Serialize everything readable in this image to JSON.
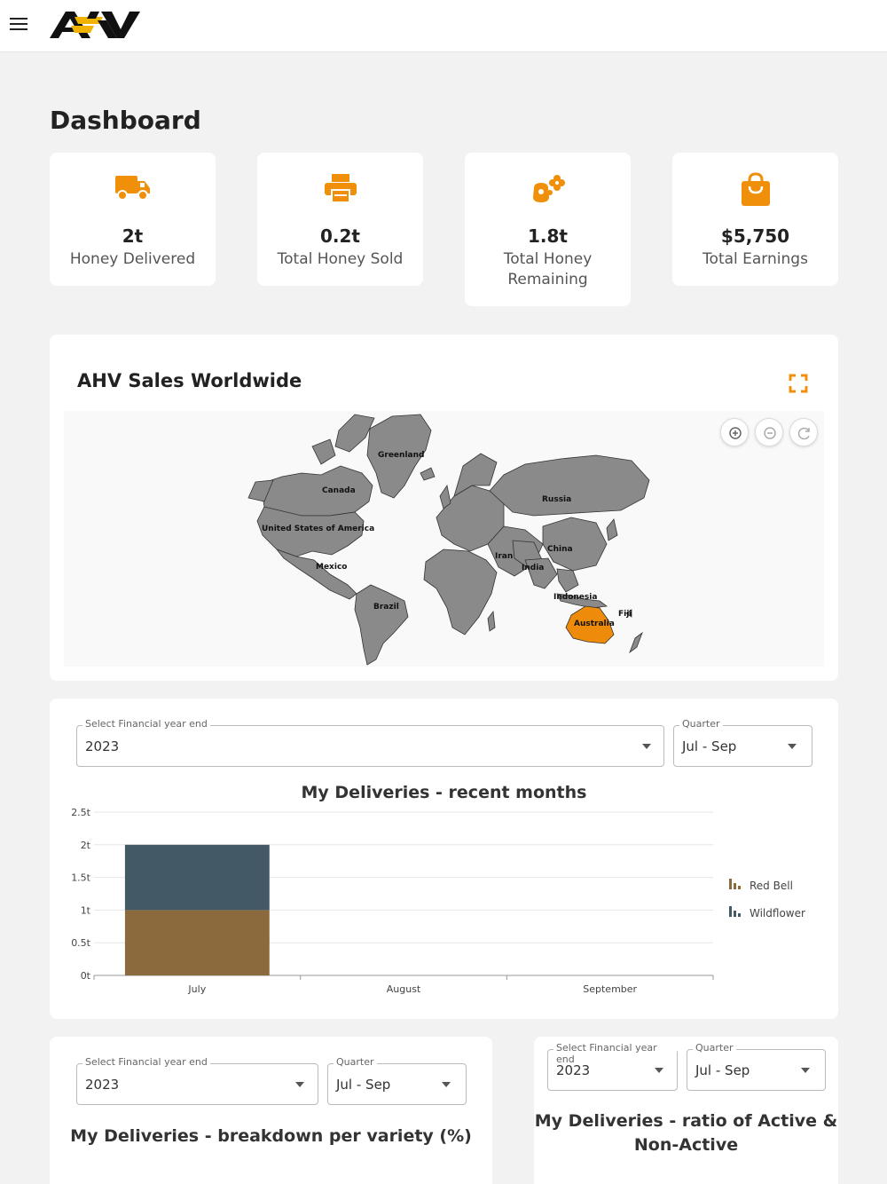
{
  "header": {
    "logo_text": "AHV"
  },
  "page": {
    "title": "Dashboard"
  },
  "stats": [
    {
      "value": "2t",
      "label": "Honey Delivered",
      "icon": "truck-icon"
    },
    {
      "value": "0.2t",
      "label": "Total Honey Sold",
      "icon": "printer-icon"
    },
    {
      "value": "1.8t",
      "label": "Total Honey Remaining",
      "icon": "honey-pot-icon"
    },
    {
      "value": "$5,750",
      "label": "Total Earnings",
      "icon": "shopping-bag-icon"
    }
  ],
  "colors": {
    "accent": "#f0900a",
    "highlight_country": "#ef8b0a",
    "country": "#8a8a8a",
    "red_bell": "#8b6b3e",
    "wildflower": "#445966"
  },
  "map": {
    "title": "AHV Sales Worldwide",
    "highlighted": "Australia",
    "labels": [
      "Greenland",
      "Canada",
      "United States of America",
      "Russia",
      "Mexico",
      "Iran",
      "China",
      "India",
      "Brazil",
      "Indonesia",
      "Fiji",
      "Australia"
    ]
  },
  "deliveries_chart": {
    "year_label": "Select Financial year end",
    "year_value": "2023",
    "quarter_label": "Quarter",
    "quarter_value": "Jul - Sep"
  },
  "chart_data": {
    "type": "bar",
    "stacked": true,
    "title": "My Deliveries - recent months",
    "categories": [
      "July",
      "August",
      "September"
    ],
    "series": [
      {
        "name": "Red Bell",
        "values": [
          1,
          0,
          0
        ]
      },
      {
        "name": "Wildflower",
        "values": [
          1,
          0,
          0
        ]
      }
    ],
    "y_ticks": [
      "0t",
      "0.5t",
      "1t",
      "1.5t",
      "2t",
      "2.5t"
    ],
    "ylim": [
      0,
      2.5
    ],
    "legend": "right",
    "grid": true
  },
  "breakdown": {
    "year_label": "Select Financial year end",
    "year_value": "2023",
    "quarter_label": "Quarter",
    "quarter_value": "Jul - Sep",
    "title": "My Deliveries - breakdown per variety (%)"
  },
  "ratio": {
    "year_label": "Select Financial year end",
    "year_value": "2023",
    "quarter_label": "Quarter",
    "quarter_value": "Jul - Sep",
    "title_line1": "My Deliveries - ratio of Active &",
    "title_line2": "Non-Active"
  }
}
